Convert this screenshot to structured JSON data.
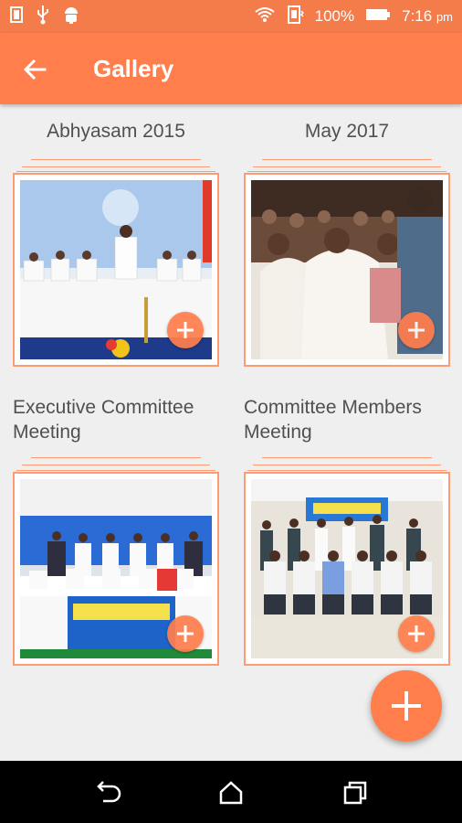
{
  "status_bar": {
    "battery_text": "100%",
    "time": "7:16",
    "time_suffix": "pm",
    "left_icons": [
      "sim-card-icon",
      "usb-icon",
      "android-icon"
    ],
    "right_icons": [
      "wifi-icon",
      "vibrate-icon",
      "battery-icon"
    ]
  },
  "app_bar": {
    "title": "Gallery",
    "back_icon": "arrow-back-icon",
    "background": "#ff7e4c"
  },
  "albums": [
    {
      "title": "Abhyasam 2015",
      "photo_desc": "stage event with speaker"
    },
    {
      "title": "May 2017",
      "photo_desc": "audience seated"
    },
    {
      "title": "Executive Committee Meeting",
      "photo_desc": "group photo on stage"
    },
    {
      "title": "Committee Members Meeting",
      "photo_desc": "group photo in hall"
    }
  ],
  "fab": {
    "icon": "plus-icon"
  },
  "nav_bar": {
    "buttons": [
      "back-nav-icon",
      "home-nav-icon",
      "recents-nav-icon"
    ]
  },
  "colors": {
    "accent": "#ff7e4c",
    "frame": "#ff9b73",
    "background": "#efefef"
  }
}
